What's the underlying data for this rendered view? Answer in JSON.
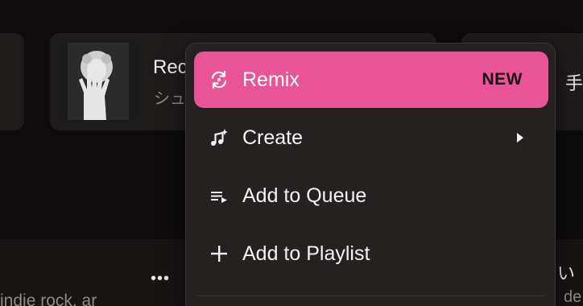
{
  "cards": {
    "main": {
      "title": "Rec",
      "artist": "シュ"
    },
    "right": {
      "title": "手"
    }
  },
  "lower": {
    "more_label": "•••",
    "genre_text": "indie rock, ar",
    "right_line1": "い",
    "right_line2": "de"
  },
  "context_menu": {
    "items": [
      {
        "label": "Remix",
        "icon": "remix-icon",
        "badge": "NEW",
        "highlighted": true
      },
      {
        "label": "Create",
        "icon": "create-music-icon",
        "has_submenu": true
      },
      {
        "label": "Add to Queue",
        "icon": "queue-icon"
      },
      {
        "label": "Add to Playlist",
        "icon": "plus-icon"
      }
    ]
  },
  "colors": {
    "accent": "#e95496",
    "menu_bg": "#252121",
    "page_bg": "#0d0b0b",
    "card_bg": "#1e1b1b"
  }
}
